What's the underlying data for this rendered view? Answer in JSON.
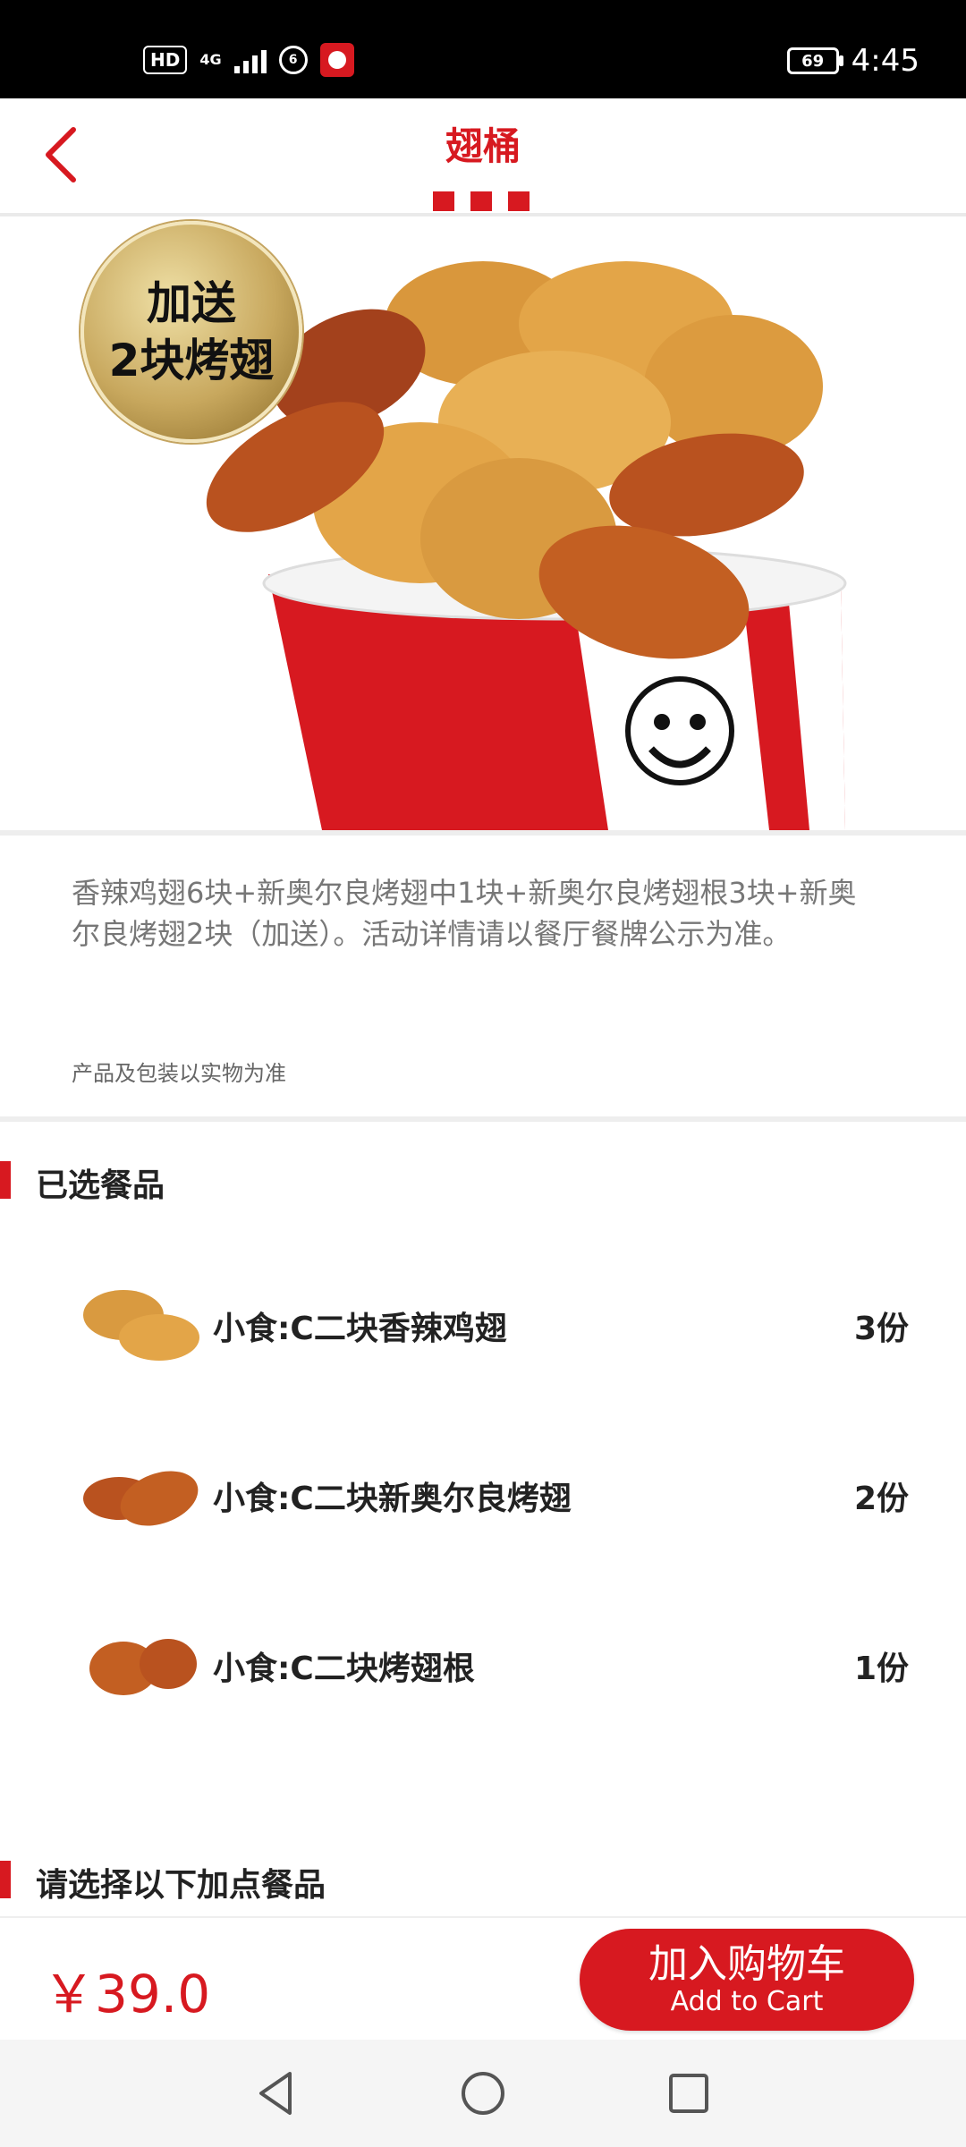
{
  "status_bar": {
    "hd": "HD",
    "network": "4G",
    "battery": "69",
    "time": "4:45"
  },
  "header": {
    "title": "翅桶"
  },
  "hero": {
    "badge_line1": "加送",
    "badge_line2": "2块烤翅"
  },
  "description": {
    "text": "香辣鸡翅6块+新奥尔良烤翅中1块+新奥尔良烤翅根3块+新奥尔良烤翅2块（加送）。活动详情请以餐厅餐牌公示为准。",
    "note": "产品及包装以实物为准"
  },
  "selected": {
    "title": "已选餐品",
    "items": [
      {
        "name": "小食:C二块香辣鸡翅",
        "qty": "3份"
      },
      {
        "name": "小食:C二块新奥尔良烤翅",
        "qty": "2份"
      },
      {
        "name": "小食:C二块烤翅根",
        "qty": "1份"
      }
    ]
  },
  "addons": {
    "title": "请选择以下加点餐品"
  },
  "bottom": {
    "price": "￥39.0",
    "cart_zh": "加入购物车",
    "cart_en": "Add to Cart"
  },
  "colors": {
    "brand_red": "#d71920"
  }
}
